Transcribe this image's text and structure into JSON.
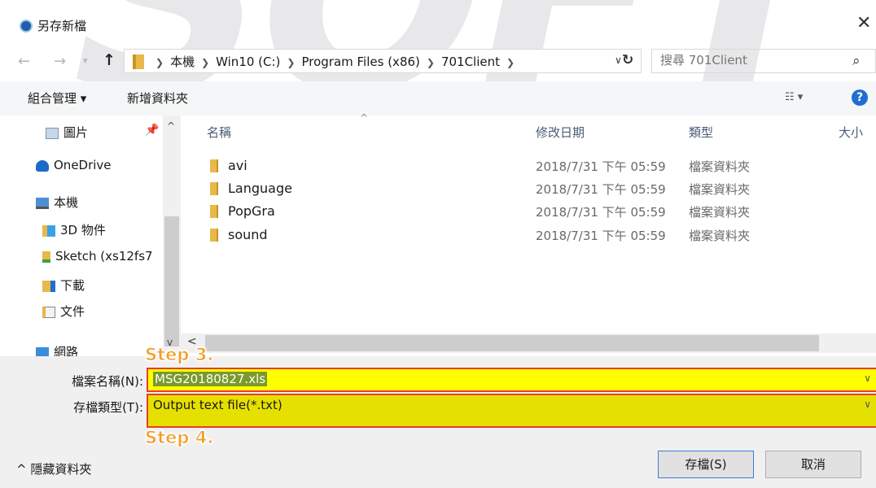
{
  "window": {
    "title": "另存新檔"
  },
  "watermark": "SOFT",
  "address": {
    "segments": [
      "本機",
      "Win10 (C:)",
      "Program Files (x86)",
      "701Client"
    ]
  },
  "search": {
    "placeholder": "搜尋 701Client"
  },
  "toolbar": {
    "organize": "組合管理 ▾",
    "new_folder": "新增資料夾"
  },
  "nav": {
    "items": [
      "圖片",
      "OneDrive",
      "本機",
      "3D 物件",
      "Sketch (xs12fs7",
      "下載",
      "文件",
      "網路"
    ]
  },
  "columns": {
    "name": "名稱",
    "modified": "修改日期",
    "type": "類型",
    "size": "大小"
  },
  "files": [
    {
      "name": "avi",
      "modified": "2018/7/31 下午 05:59",
      "type": "檔案資料夾"
    },
    {
      "name": "Language",
      "modified": "2018/7/31 下午 05:59",
      "type": "檔案資料夾"
    },
    {
      "name": "PopGra",
      "modified": "2018/7/31 下午 05:59",
      "type": "檔案資料夾"
    },
    {
      "name": "sound",
      "modified": "2018/7/31 下午 05:59",
      "type": "檔案資料夾"
    }
  ],
  "form": {
    "filename_label": "檔案名稱(N):",
    "filename_value": "MSG20180827.xls",
    "filetype_label": "存檔類型(T):",
    "filetype_value": "Output text file(*.txt)"
  },
  "annotations": {
    "step3": "Step 3.",
    "step4": "Step 4."
  },
  "footer": {
    "hide_folders": "隱藏資料夾",
    "save": "存檔(S)",
    "cancel": "取消"
  }
}
